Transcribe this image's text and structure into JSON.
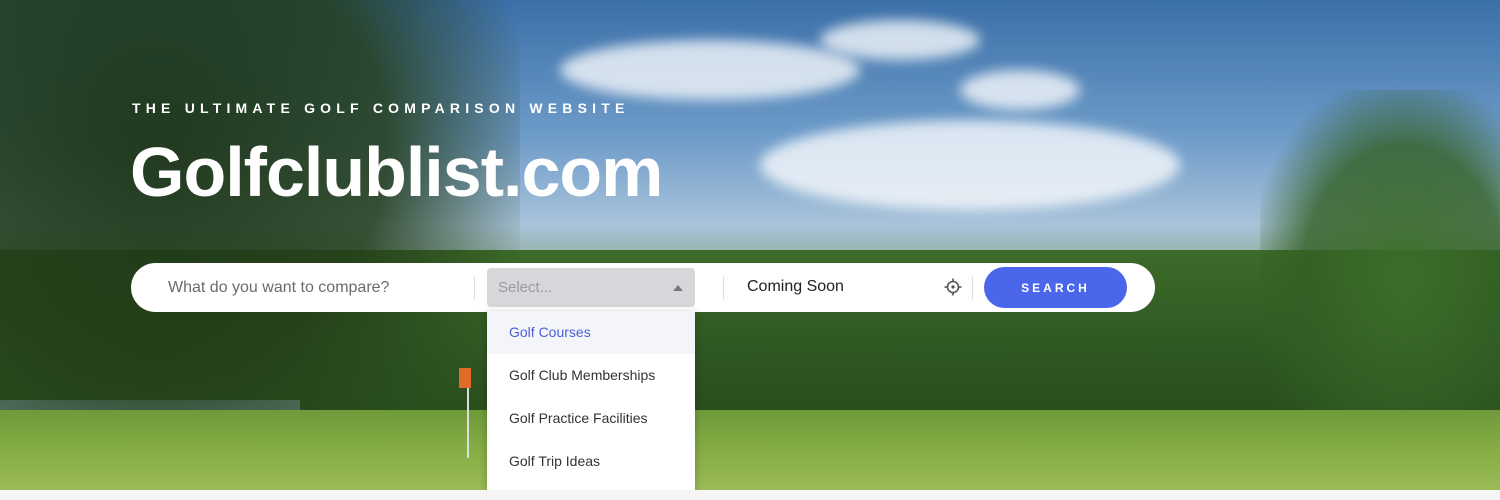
{
  "hero": {
    "tagline": "The Ultimate Golf Comparison Website",
    "title": "Golfclublist.com"
  },
  "search": {
    "compare_placeholder": "What do you want to compare?",
    "select_placeholder": "Select...",
    "location_value": "Coming Soon",
    "button_label": "SEARCH"
  },
  "dropdown": {
    "items": [
      {
        "label": "Golf Courses",
        "active": true
      },
      {
        "label": "Golf Club Memberships",
        "active": false
      },
      {
        "label": "Golf Practice Facilities",
        "active": false
      },
      {
        "label": "Golf Trip Ideas",
        "active": false
      }
    ]
  },
  "colors": {
    "accent": "#4a66ea",
    "active_item_text": "#4a5ed8"
  },
  "icons": {
    "location": "crosshair-icon",
    "select": "caret-up-icon"
  }
}
